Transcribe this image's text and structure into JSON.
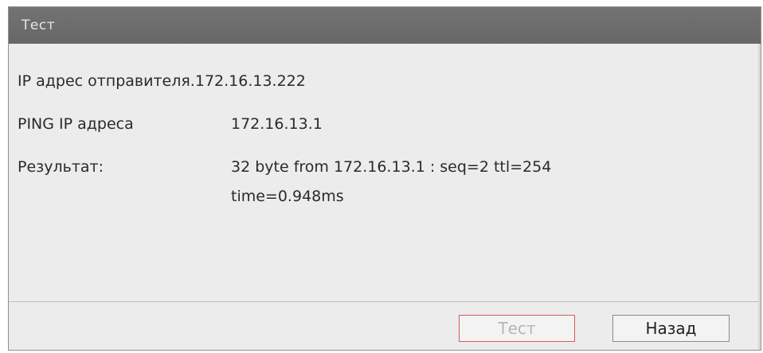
{
  "dialog": {
    "title": "Тест"
  },
  "sender": {
    "label": "IP адрес отправителя.",
    "value": "172.16.13.222"
  },
  "ping": {
    "label": "PING IP адреса",
    "value": "172.16.13.1"
  },
  "result": {
    "label": "Результат:",
    "line1": "32 byte from 172.16.13.1 : seq=2 ttl=254",
    "line2": "time=0.948ms"
  },
  "buttons": {
    "test_label": "Тест",
    "back_label": "Назад"
  }
}
